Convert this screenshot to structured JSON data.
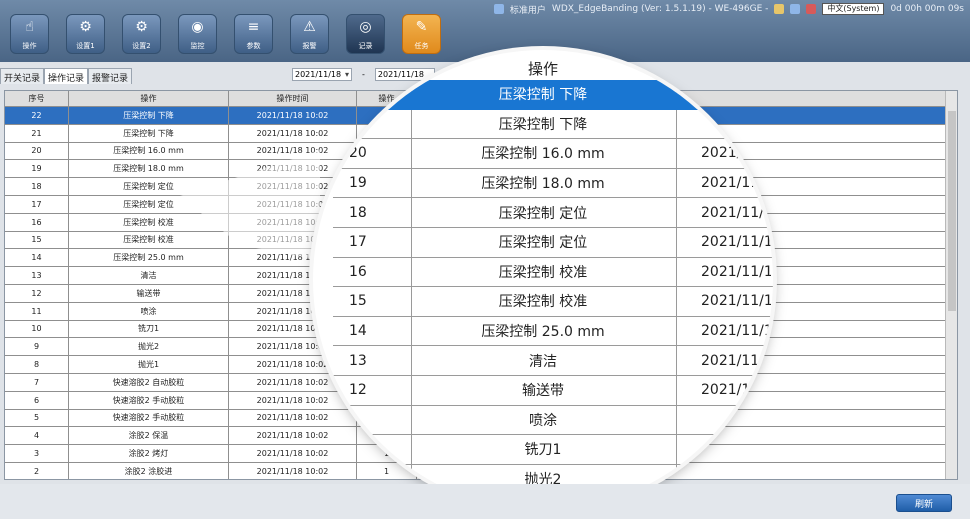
{
  "status": {
    "user": "标准用户",
    "app_info": "WDX_EdgeBanding (Ver: 1.5.1.19) - WE-496GE -",
    "language": "中文(System)",
    "runtime": "0d 00h 00m 09s"
  },
  "toolbar": [
    {
      "label": "操作",
      "icon": "hand-icon"
    },
    {
      "label": "设置1",
      "icon": "gear-icon"
    },
    {
      "label": "设置2",
      "icon": "gear-icon"
    },
    {
      "label": "监控",
      "icon": "monitor-icon"
    },
    {
      "label": "参数",
      "icon": "sliders-icon"
    },
    {
      "label": "报警",
      "icon": "alarm-icon"
    },
    {
      "label": "记录",
      "icon": "record-icon"
    },
    {
      "label": "任务",
      "icon": "task-icon"
    }
  ],
  "tabs": [
    "开关记录",
    "操作记录",
    "报警记录"
  ],
  "date_filter": {
    "from": "2021/11/18",
    "to": "2021/11/18",
    "separator": "-"
  },
  "table": {
    "headers": [
      "序号",
      "操作",
      "操作时间",
      "操作"
    ],
    "rows": [
      {
        "no": "22",
        "op": "压梁控制  下降",
        "time": "2021/11/18 10:02",
        "extra": ""
      },
      {
        "no": "21",
        "op": "压梁控制  下降",
        "time": "2021/11/18 10:02",
        "extra": ""
      },
      {
        "no": "20",
        "op": "压梁控制  16.0 mm",
        "time": "2021/11/18 10:02",
        "extra": ""
      },
      {
        "no": "19",
        "op": "压梁控制  18.0 mm",
        "time": "2021/11/18 10:02",
        "extra": ""
      },
      {
        "no": "18",
        "op": "压梁控制  定位",
        "time": "2021/11/18 10:02",
        "extra": ""
      },
      {
        "no": "17",
        "op": "压梁控制  定位",
        "time": "2021/11/18 10:02",
        "extra": ""
      },
      {
        "no": "16",
        "op": "压梁控制  校准",
        "time": "2021/11/18 10:02",
        "extra": ""
      },
      {
        "no": "15",
        "op": "压梁控制  校准",
        "time": "2021/11/18 10:02",
        "extra": ""
      },
      {
        "no": "14",
        "op": "压梁控制  25.0 mm",
        "time": "2021/11/18 10:02",
        "extra": ""
      },
      {
        "no": "13",
        "op": "清洁",
        "time": "2021/11/18 10:02",
        "extra": ""
      },
      {
        "no": "12",
        "op": "输送带",
        "time": "2021/11/18 10:02",
        "extra": ""
      },
      {
        "no": "11",
        "op": "喷涂",
        "time": "2021/11/18 10:02",
        "extra": ""
      },
      {
        "no": "10",
        "op": "铣刀1",
        "time": "2021/11/18 10:02",
        "extra": ""
      },
      {
        "no": "9",
        "op": "抛光2",
        "time": "2021/11/18 10:02",
        "extra": ""
      },
      {
        "no": "8",
        "op": "抛光1",
        "time": "2021/11/18 10:02",
        "extra": ""
      },
      {
        "no": "7",
        "op": "快速溶胶2  自动胶粒",
        "time": "2021/11/18 10:02",
        "extra": ""
      },
      {
        "no": "6",
        "op": "快速溶胶2  手动胶粒",
        "time": "2021/11/18 10:02",
        "extra": ""
      },
      {
        "no": "5",
        "op": "快速溶胶2  手动胶粒",
        "time": "2021/11/18 10:02",
        "extra": ""
      },
      {
        "no": "4",
        "op": "涂胶2  保温",
        "time": "2021/11/18 10:02",
        "extra": ""
      },
      {
        "no": "3",
        "op": "涂胶2  烤灯",
        "time": "2021/11/18 10:02",
        "extra": "1"
      },
      {
        "no": "2",
        "op": "涂胶2  涂胶进",
        "time": "2021/11/18 10:02",
        "extra": "1"
      }
    ]
  },
  "refresh_label": "刷新",
  "magnifier": {
    "header": "操作",
    "rows": [
      {
        "no": "",
        "op": "压梁控制  下降",
        "time": ""
      },
      {
        "no": "",
        "op": "压梁控制  下降",
        "time": ""
      },
      {
        "no": "20",
        "op": "压梁控制  16.0 mm",
        "time": "2021/11/18"
      },
      {
        "no": "19",
        "op": "压梁控制  18.0 mm",
        "time": "2021/11/18"
      },
      {
        "no": "18",
        "op": "压梁控制  定位",
        "time": "2021/11/18"
      },
      {
        "no": "17",
        "op": "压梁控制  定位",
        "time": "2021/11/18"
      },
      {
        "no": "16",
        "op": "压梁控制  校准",
        "time": "2021/11/18"
      },
      {
        "no": "15",
        "op": "压梁控制  校准",
        "time": "2021/11/18"
      },
      {
        "no": "14",
        "op": "压梁控制  25.0 mm",
        "time": "2021/11/18"
      },
      {
        "no": "13",
        "op": "清洁",
        "time": "2021/11/18"
      },
      {
        "no": "12",
        "op": "输送带",
        "time": "2021/11/18"
      },
      {
        "no": "",
        "op": "喷涂",
        "time": ""
      },
      {
        "no": "",
        "op": "铣刀1",
        "time": ""
      },
      {
        "no": "",
        "op": "抛光2",
        "time": ""
      }
    ]
  },
  "colors": {
    "selected": "#2d6fc0",
    "toolbar_warn": "#f0a23a"
  }
}
